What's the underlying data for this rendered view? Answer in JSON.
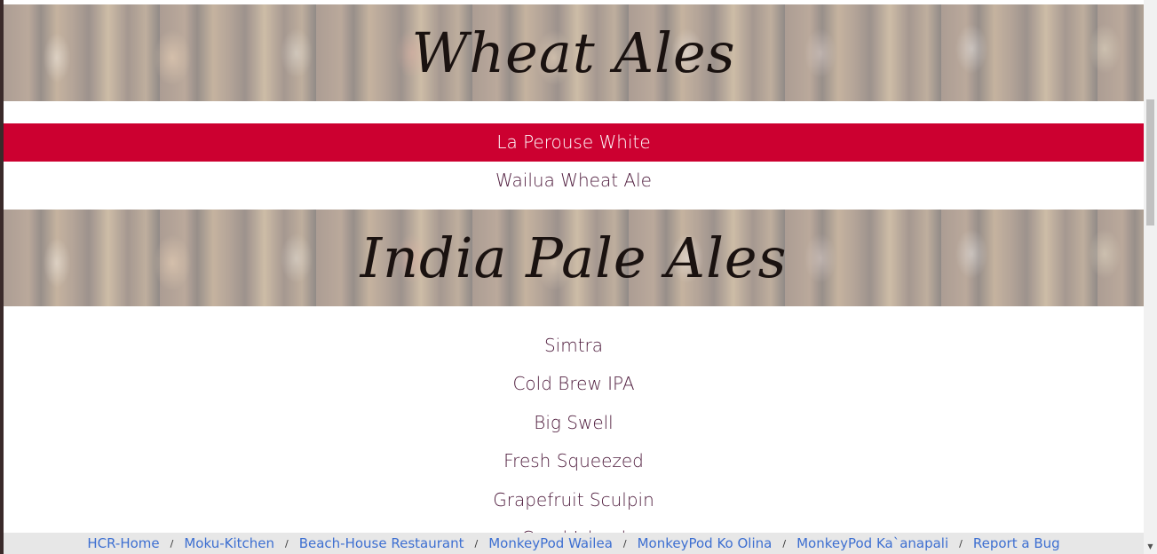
{
  "sections": [
    {
      "heading": "Wheat Ales",
      "beers": [
        "La Perouse White",
        "Wailua Wheat Ale"
      ],
      "active_index": 0
    },
    {
      "heading": "India Pale Ales",
      "beers": [
        "Simtra",
        "Cold Brew IPA",
        "Big Swell",
        "Fresh Squeezed",
        "Grapefruit Sculpin",
        "Coral Island"
      ]
    }
  ],
  "footer": {
    "links": [
      "HCR-Home",
      "Moku-Kitchen",
      "Beach-House Restaurant",
      "MonkeyPod Wailea",
      "MonkeyPod Ko Olina",
      "MonkeyPod Ka`anapali",
      "Report a Bug"
    ],
    "separator": "/"
  },
  "colors": {
    "active_row": "#cc0030",
    "beer_text": "#4e1b3c",
    "link": "#3d6fd1"
  },
  "scrollbar": {
    "down_arrow_icon": "▼"
  }
}
